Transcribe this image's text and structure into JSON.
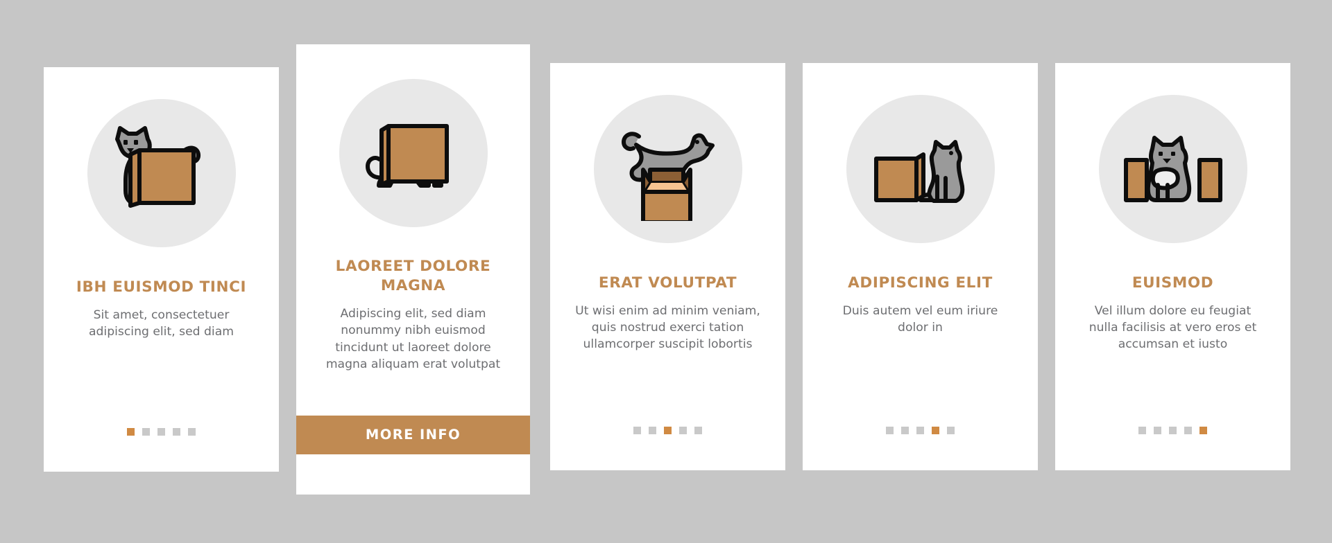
{
  "page": {
    "background_color": "#c6c6c6",
    "accent_color": "#c08a52",
    "dot_active_color": "#d08a43",
    "dot_inactive_color": "#c9c9c9",
    "title_color": "#c08a52",
    "body_color": "#6d6e71",
    "icon_circle_color": "#e8e8e8",
    "box_color": "#c08a52",
    "cat_color": "#9a9a9a"
  },
  "cards": [
    {
      "id": "card-1",
      "icon_name": "cat-behind-box-icon",
      "title": "IBH EUISMOD TINCI",
      "body": "Sit amet, consectetuer adipiscing elit, sed diam",
      "dots": {
        "count": 5,
        "active_index": 0
      },
      "has_more_info": false,
      "more_info_label": ""
    },
    {
      "id": "card-2",
      "icon_name": "cat-under-box-icon",
      "title": "LAOREET DOLORE MAGNA",
      "body": "Adipiscing elit, sed diam nonummy nibh euismod tincidunt ut laoreet dolore magna aliquam erat volutpat",
      "dots": {
        "count": 5,
        "active_index": 1
      },
      "has_more_info": true,
      "more_info_label": "MORE INFO"
    },
    {
      "id": "card-3",
      "icon_name": "cat-jumping-over-open-box-icon",
      "title": "ERAT VOLUTPAT",
      "body": "Ut wisi enim ad minim veniam, quis nostrud exerci tation ullamcorper suscipit lobortis",
      "dots": {
        "count": 5,
        "active_index": 2
      },
      "has_more_info": false,
      "more_info_label": ""
    },
    {
      "id": "card-4",
      "icon_name": "cat-sitting-beside-box-icon",
      "title": "ADIPISCING ELIT",
      "body": "Duis autem vel eum iriure dolor in",
      "dots": {
        "count": 5,
        "active_index": 3
      },
      "has_more_info": false,
      "more_info_label": ""
    },
    {
      "id": "card-5",
      "icon_name": "cat-between-two-boxes-icon",
      "title": "EUISMOD",
      "body": "Vel illum dolore eu feugiat nulla facilisis at vero eros et accumsan et iusto",
      "dots": {
        "count": 5,
        "active_index": 4
      },
      "has_more_info": false,
      "more_info_label": ""
    }
  ]
}
